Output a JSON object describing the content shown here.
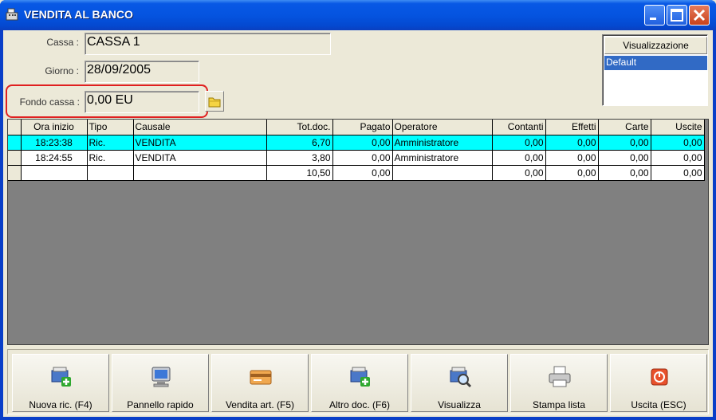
{
  "window": {
    "title": "VENDITA AL BANCO"
  },
  "form": {
    "cassa_label": "Cassa :",
    "cassa_value": "CASSA 1",
    "giorno_label": "Giorno :",
    "giorno_value": "28/09/2005",
    "fondo_label": "Fondo cassa :",
    "fondo_value": "0,00 EU"
  },
  "visualizzazione": {
    "header": "Visualizzazione",
    "items": [
      "Default"
    ]
  },
  "table": {
    "columns": [
      "Ora inizio",
      "Tipo",
      "Causale",
      "Tot.doc.",
      "Pagato",
      "Operatore",
      "Contanti",
      "Effetti",
      "Carte",
      "Uscite"
    ],
    "rows": [
      [
        "18:23:38",
        "Ric.",
        "VENDITA",
        "6,70",
        "0,00",
        "Amministratore",
        "0,00",
        "0,00",
        "0,00",
        "0,00"
      ],
      [
        "18:24:55",
        "Ric.",
        "VENDITA",
        "3,80",
        "0,00",
        "Amministratore",
        "0,00",
        "0,00",
        "0,00",
        "0,00"
      ]
    ],
    "totals": [
      "",
      "",
      "",
      "10,50",
      "0,00",
      "",
      "0,00",
      "0,00",
      "0,00",
      "0,00"
    ]
  },
  "buttons": [
    {
      "label": "Nuova ric. (F4)",
      "icon": "new-receipt-icon"
    },
    {
      "label": "Pannello rapido",
      "icon": "monitor-icon"
    },
    {
      "label": "Vendita art. (F5)",
      "icon": "card-icon"
    },
    {
      "label": "Altro doc. (F6)",
      "icon": "new-document-icon"
    },
    {
      "label": "Visualizza",
      "icon": "view-icon"
    },
    {
      "label": "Stampa lista",
      "icon": "printer-icon"
    },
    {
      "label": "Uscita (ESC)",
      "icon": "exit-icon"
    }
  ],
  "colors": {
    "selected_row": "#00ffff",
    "highlight_border": "#e02020",
    "title_bar": "#0554e0"
  }
}
